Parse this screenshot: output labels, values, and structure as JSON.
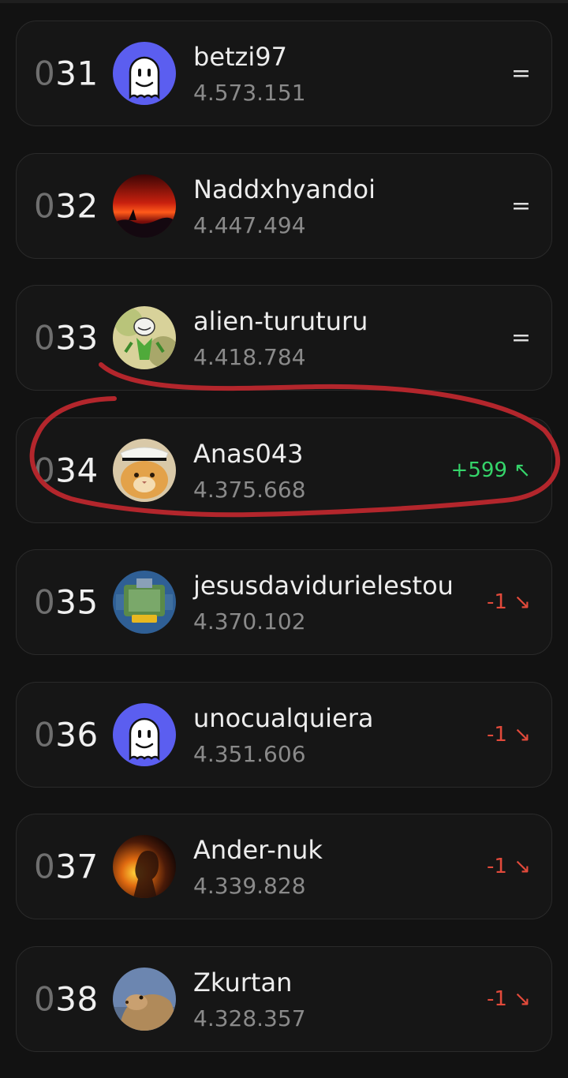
{
  "leaderboard": {
    "rows": [
      {
        "pad": "0",
        "rank": "31",
        "name": "betzi97",
        "score": "4.573.151",
        "change": "=",
        "trend": "same",
        "avatar": "ghost-avatar"
      },
      {
        "pad": "0",
        "rank": "32",
        "name": "Naddxhyandoi",
        "score": "4.447.494",
        "change": "=",
        "trend": "same",
        "avatar": "sunset-avatar"
      },
      {
        "pad": "0",
        "rank": "33",
        "name": "alien-turuturu",
        "score": "4.418.784",
        "change": "=",
        "trend": "same",
        "avatar": "trollface-avatar"
      },
      {
        "pad": "0",
        "rank": "34",
        "name": "Anas043",
        "score": "4.375.668",
        "change": "+599 ↖",
        "trend": "up",
        "avatar": "cat-avatar"
      },
      {
        "pad": "0",
        "rank": "35",
        "name": "jesusdavidurielestou",
        "score": "4.370.102",
        "change": "-1 ↘",
        "trend": "down",
        "avatar": "game-arena-avatar"
      },
      {
        "pad": "0",
        "rank": "36",
        "name": "unocualquiera",
        "score": "4.351.606",
        "change": "-1 ↘",
        "trend": "down",
        "avatar": "ghost-avatar"
      },
      {
        "pad": "0",
        "rank": "37",
        "name": "Ander-nuk",
        "score": "4.339.828",
        "change": "-1 ↘",
        "trend": "down",
        "avatar": "fire-portrait-avatar"
      },
      {
        "pad": "0",
        "rank": "38",
        "name": "Zkurtan",
        "score": "4.328.357",
        "change": "-1 ↘",
        "trend": "down",
        "avatar": "prairie-dog-avatar"
      }
    ]
  },
  "colors": {
    "background": "#121212",
    "card": "#161616",
    "ghost_avatar": "#5b5ef0",
    "trend_up": "#35d46a",
    "trend_down": "#e24a3b",
    "annotation": "#b3262c"
  }
}
